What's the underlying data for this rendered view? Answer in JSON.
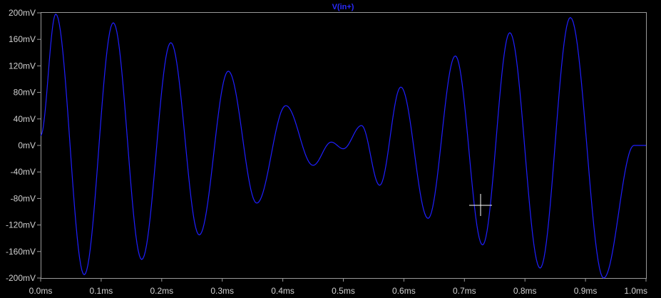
{
  "window": {
    "trace_label": "V(in+)"
  },
  "chart_data": {
    "type": "line",
    "title": "V(in+)",
    "xlabel": "",
    "ylabel": "",
    "xlim": [
      0.0,
      1.0
    ],
    "ylim": [
      -200,
      200
    ],
    "x_unit": "ms",
    "y_unit": "mV",
    "x_ticks": [
      "0.0ms",
      "0.1ms",
      "0.2ms",
      "0.3ms",
      "0.4ms",
      "0.5ms",
      "0.6ms",
      "0.7ms",
      "0.8ms",
      "0.9ms",
      "1.0ms"
    ],
    "y_ticks": [
      "200mV",
      "160mV",
      "120mV",
      "80mV",
      "40mV",
      "0mV",
      "-40mV",
      "-80mV",
      "-120mV",
      "-160mV",
      "-200mV"
    ],
    "grid": false,
    "background": "#000000",
    "series": [
      {
        "name": "V(in+)",
        "color": "#1f1fff",
        "x": [
          0.0,
          0.025,
          0.072,
          0.12,
          0.167,
          0.215,
          0.262,
          0.31,
          0.357,
          0.405,
          0.45,
          0.48,
          0.5,
          0.53,
          0.56,
          0.595,
          0.64,
          0.685,
          0.73,
          0.775,
          0.825,
          0.875,
          0.93,
          0.98,
          1.0
        ],
        "values": [
          15,
          198,
          -195,
          185,
          -172,
          155,
          -135,
          112,
          -87,
          60,
          -30,
          5,
          -5,
          30,
          -60,
          88,
          -110,
          135,
          -150,
          170,
          -185,
          193,
          -200,
          0,
          0
        ]
      }
    ]
  }
}
